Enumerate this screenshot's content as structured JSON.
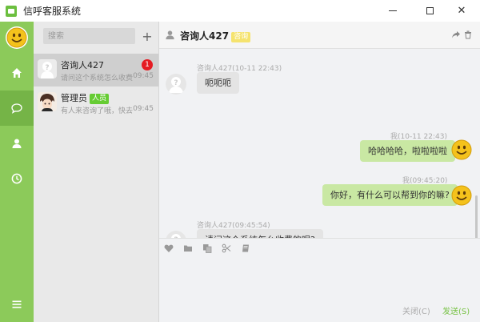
{
  "window": {
    "title": "信呼客服系统"
  },
  "nav": {
    "items": [
      {
        "name": "home-icon",
        "active": false
      },
      {
        "name": "chat-icon",
        "active": true
      },
      {
        "name": "user-icon",
        "active": false
      },
      {
        "name": "history-icon",
        "active": false
      },
      {
        "name": "menu-icon",
        "active": false
      }
    ]
  },
  "contacts": {
    "search_placeholder": "搜索",
    "add_label": "+",
    "items": [
      {
        "name": "咨询人427",
        "tag": "",
        "preview": "请问这个系统怎么收费的",
        "time": "09:45",
        "unread": "1"
      },
      {
        "name": "管理员",
        "tag": "人员",
        "preview": "有人来咨询了哦，快去处",
        "time": "09:45",
        "unread": ""
      }
    ]
  },
  "chat": {
    "title": "咨询人427",
    "title_tag": "咨询",
    "messages": [
      {
        "direction": "in",
        "meta": "咨询人427(10-11 22:43)",
        "text": "呃呃呃"
      },
      {
        "direction": "out",
        "meta": "我(10-11 22:43)",
        "text": "哈哈哈哈，啦啦啦啦"
      },
      {
        "direction": "out",
        "meta": "我(09:45:20)",
        "text": "你好，有什么可以帮到你的嘛?"
      },
      {
        "direction": "in",
        "meta": "咨询人427(09:45:54)",
        "text": "请问这个系统怎么收费的呢?"
      }
    ],
    "close_label": "关闭(C)",
    "send_label": "发送(S)"
  },
  "colors": {
    "accent": "#8cca5a",
    "nav_active": "#75b447",
    "bubble_out": "#c9e8a3",
    "bubble_in": "#e4e4e4",
    "badge": "#e51c23"
  }
}
